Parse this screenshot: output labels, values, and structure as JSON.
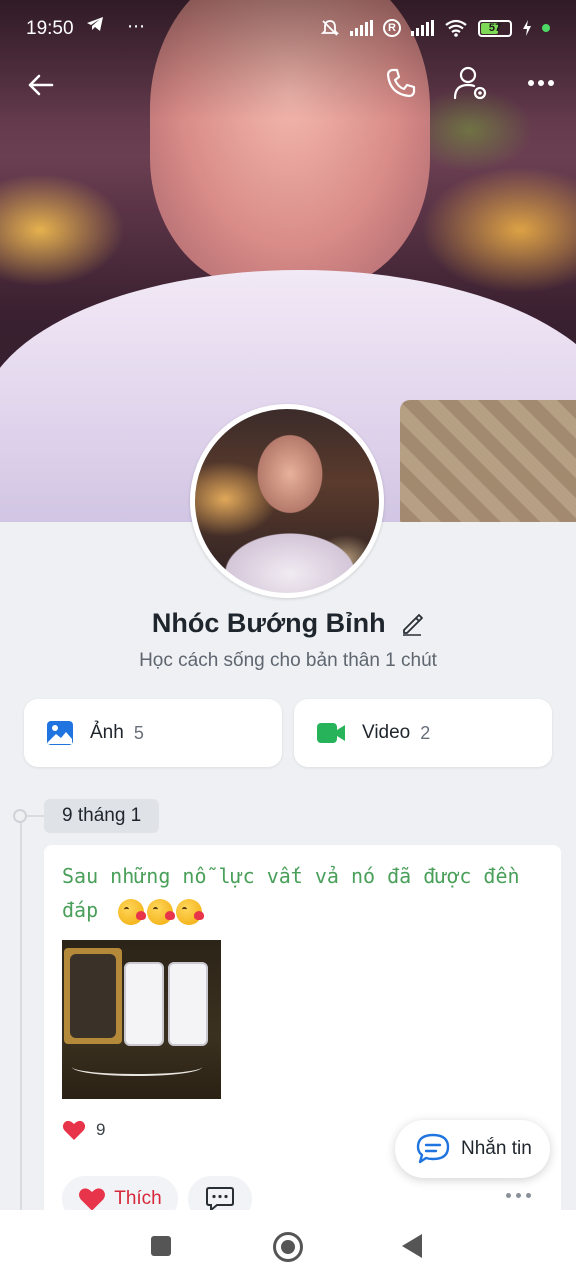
{
  "status_bar": {
    "time": "19:50",
    "extra_icons": "⋯",
    "battery_level": "57",
    "colors": {
      "battery_fill": "#7ed957",
      "charging_dot": "#4cd964"
    }
  },
  "top_bar": {
    "icons": [
      "back-arrow-icon",
      "phone-icon",
      "user-settings-icon",
      "more-options-icon"
    ]
  },
  "profile": {
    "name": "Nhóc Bướng Bỉnh",
    "bio": "Học cách sống cho bản thân 1 chút"
  },
  "media": {
    "photos_label": "Ảnh",
    "photos_count": "5",
    "videos_label": "Video",
    "videos_count": "2",
    "colors": {
      "photo_icon": "#1f74e0",
      "video_icon": "#27b35a"
    }
  },
  "timeline": {
    "date": "9 tháng 1",
    "post": {
      "text": "Sau những nỗ lực vất vả nó đã được đền đáp",
      "emojis": [
        "😘",
        "😘",
        "😘"
      ],
      "reaction_count": "9",
      "like_label": "Thích",
      "colors": {
        "text": "#4aa05a",
        "like": "#d6283a"
      }
    }
  },
  "message_button": {
    "label": "Nhắn tin"
  }
}
